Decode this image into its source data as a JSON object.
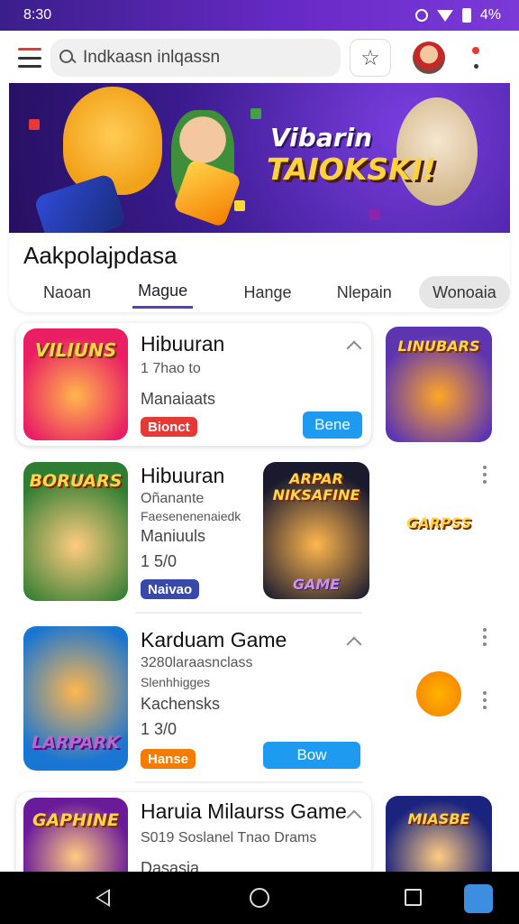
{
  "status_bar": {
    "time": "8:30",
    "battery": "4%"
  },
  "top_bar": {
    "search_placeholder": "Indkaasn inlqassn",
    "star_icon": "star-icon"
  },
  "hero": {
    "title": "Vibarin",
    "subtitle": "TAIOKSKI!"
  },
  "section": {
    "title": "Aakpolajpdasa",
    "tabs": [
      "Naoan",
      "Mague",
      "Hange",
      "Nlepain",
      "Wonoaia"
    ]
  },
  "cards": [
    {
      "thumb_label": "VILIUNS",
      "title": "Hibuuran",
      "line1": "1 7hao to",
      "line2": "Manaiaats",
      "badge": "Bionct",
      "button": "Bene",
      "side_label": "LINUBARS"
    },
    {
      "thumb_label": "BORUARS",
      "title": "Hibuuran",
      "line1": "Oñanante",
      "line2": "Faesenenenaiedk",
      "line3": "Maniuuls",
      "line4": "1 5/0",
      "badge": "Naivao",
      "poster_title": "ARPAR NIKSAFINE",
      "poster_sub": "GAME",
      "side_label": "GARPSS"
    },
    {
      "thumb_label": "LARPARK",
      "title": "Karduam Game",
      "line1": "3280laraasnclass",
      "line2": "Slenhhigges",
      "line3": "Kachensks",
      "line4": "1 3/0",
      "badge": "Hanse",
      "button": "Bow"
    },
    {
      "thumb_label": "GAPHINE",
      "title": "Haruia Milaurss Game",
      "line1": "S019 Soslanel Tnao Drams",
      "line2": "Dasasia",
      "side_label": "MIASBE"
    }
  ],
  "colors": {
    "accent": "#5c3bbd",
    "button": "#1e9af0",
    "badge_red": "#e53935",
    "badge_blue": "#3949ab",
    "badge_orange": "#f57c00"
  }
}
